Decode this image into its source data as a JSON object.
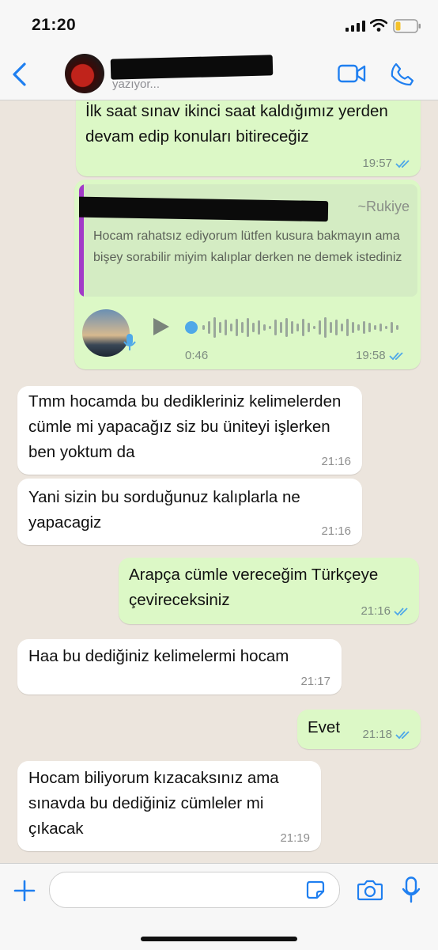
{
  "status_bar": {
    "time": "21:20"
  },
  "header": {
    "subtitle": "yazıyor..."
  },
  "colors": {
    "accent": "#1f7ff0",
    "outgoing_bubble": "#dcf8c6",
    "incoming_bubble": "#ffffff",
    "read_tick": "#4fa8e8",
    "quote_bar": "#a23bc8"
  },
  "messages": [
    {
      "dir": "out",
      "text": "İlk saat sınav ikinci saat kaldığımız yerden devam edip konuları bitireceğiz",
      "time": "19:57",
      "status": "read"
    },
    {
      "dir": "out",
      "type": "voice-reply",
      "quote_author": "~Rukiye",
      "quote_text": "Hocam rahatsız ediyorum lütfen kusura bakmayın ama bişey sorabilir miyim kalıplar derken ne demek istediniz",
      "duration": "0:46",
      "time": "19:58",
      "status": "read"
    },
    {
      "dir": "in",
      "text": "Tmm hocamda bu dedikleriniz kelimelerden cümle mi yapacağız siz bu üniteyi işlerken ben yoktum da",
      "time": "21:16"
    },
    {
      "dir": "in",
      "text": "Yani sizin bu sorduğunuz kalıplarla ne yapacagiz",
      "time": "21:16"
    },
    {
      "dir": "out",
      "text": "Arapça cümle vereceğim Türkçeye çevireceksiniz",
      "time": "21:16",
      "status": "read"
    },
    {
      "dir": "in",
      "text": "Haa bu dediğiniz kelimelermi hocam",
      "time": "21:17"
    },
    {
      "dir": "out",
      "text": "Evet",
      "time": "21:18",
      "status": "read"
    },
    {
      "dir": "in",
      "text": "Hocam biliyorum kızacaksınız ama sınavda bu dediğiniz cümleler mi çıkacak",
      "time": "21:19"
    }
  ],
  "icons": [
    "back-chevron-icon",
    "video-call-icon",
    "phone-call-icon",
    "play-icon",
    "microphone-icon",
    "plus-icon",
    "sticker-icon",
    "camera-icon"
  ]
}
